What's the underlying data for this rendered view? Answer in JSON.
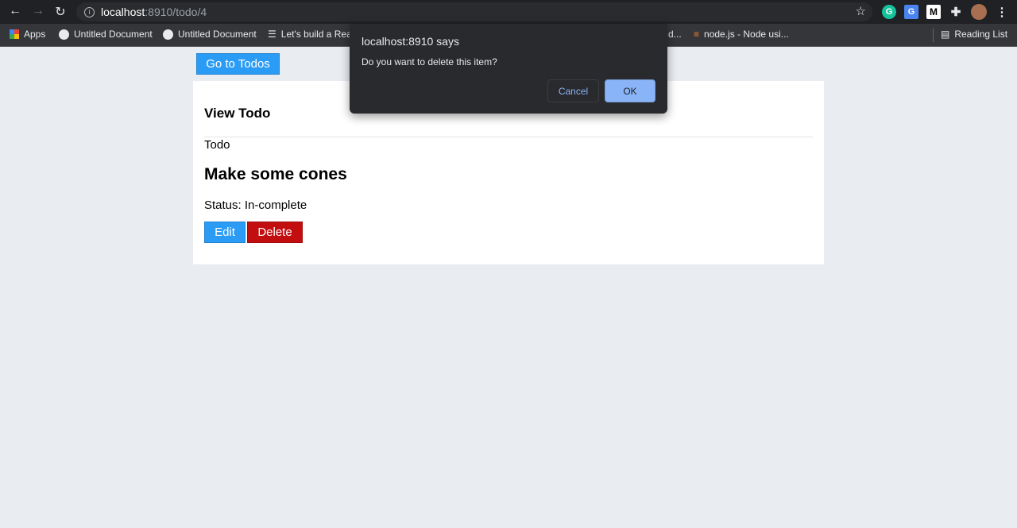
{
  "browser": {
    "url_host": "localhost",
    "url_path": ":8910/todo/4",
    "extensions": [
      "grammarly-icon",
      "google-translate-icon",
      "medium-icon",
      "puzzle-icon",
      "profile-avatar",
      "menu-icon"
    ],
    "bookmarks": [
      {
        "label": "Apps",
        "icon": "apps-grid-icon"
      },
      {
        "label": "Untitled Document",
        "icon": "globe-icon"
      },
      {
        "label": "Untitled Document",
        "icon": "globe-icon"
      },
      {
        "label": "Let's build a Rea",
        "icon": "list-icon"
      },
      {
        "label": "d...",
        "icon": ""
      },
      {
        "label": "node.js - Node usi...",
        "icon": "stackoverflow-icon"
      }
    ],
    "reading_list": "Reading List"
  },
  "page": {
    "go_to_todos": "Go to Todos",
    "heading": "View Todo",
    "label": "Todo",
    "title": "Make some cones",
    "status": "Status: In-complete",
    "edit": "Edit",
    "delete": "Delete"
  },
  "dialog": {
    "title": "localhost:8910 says",
    "message": "Do you want to delete this item?",
    "cancel": "Cancel",
    "ok": "OK"
  },
  "colors": {
    "primary": "#2b9cf5",
    "danger": "#c20e0e",
    "ok": "#8ab4f8"
  }
}
